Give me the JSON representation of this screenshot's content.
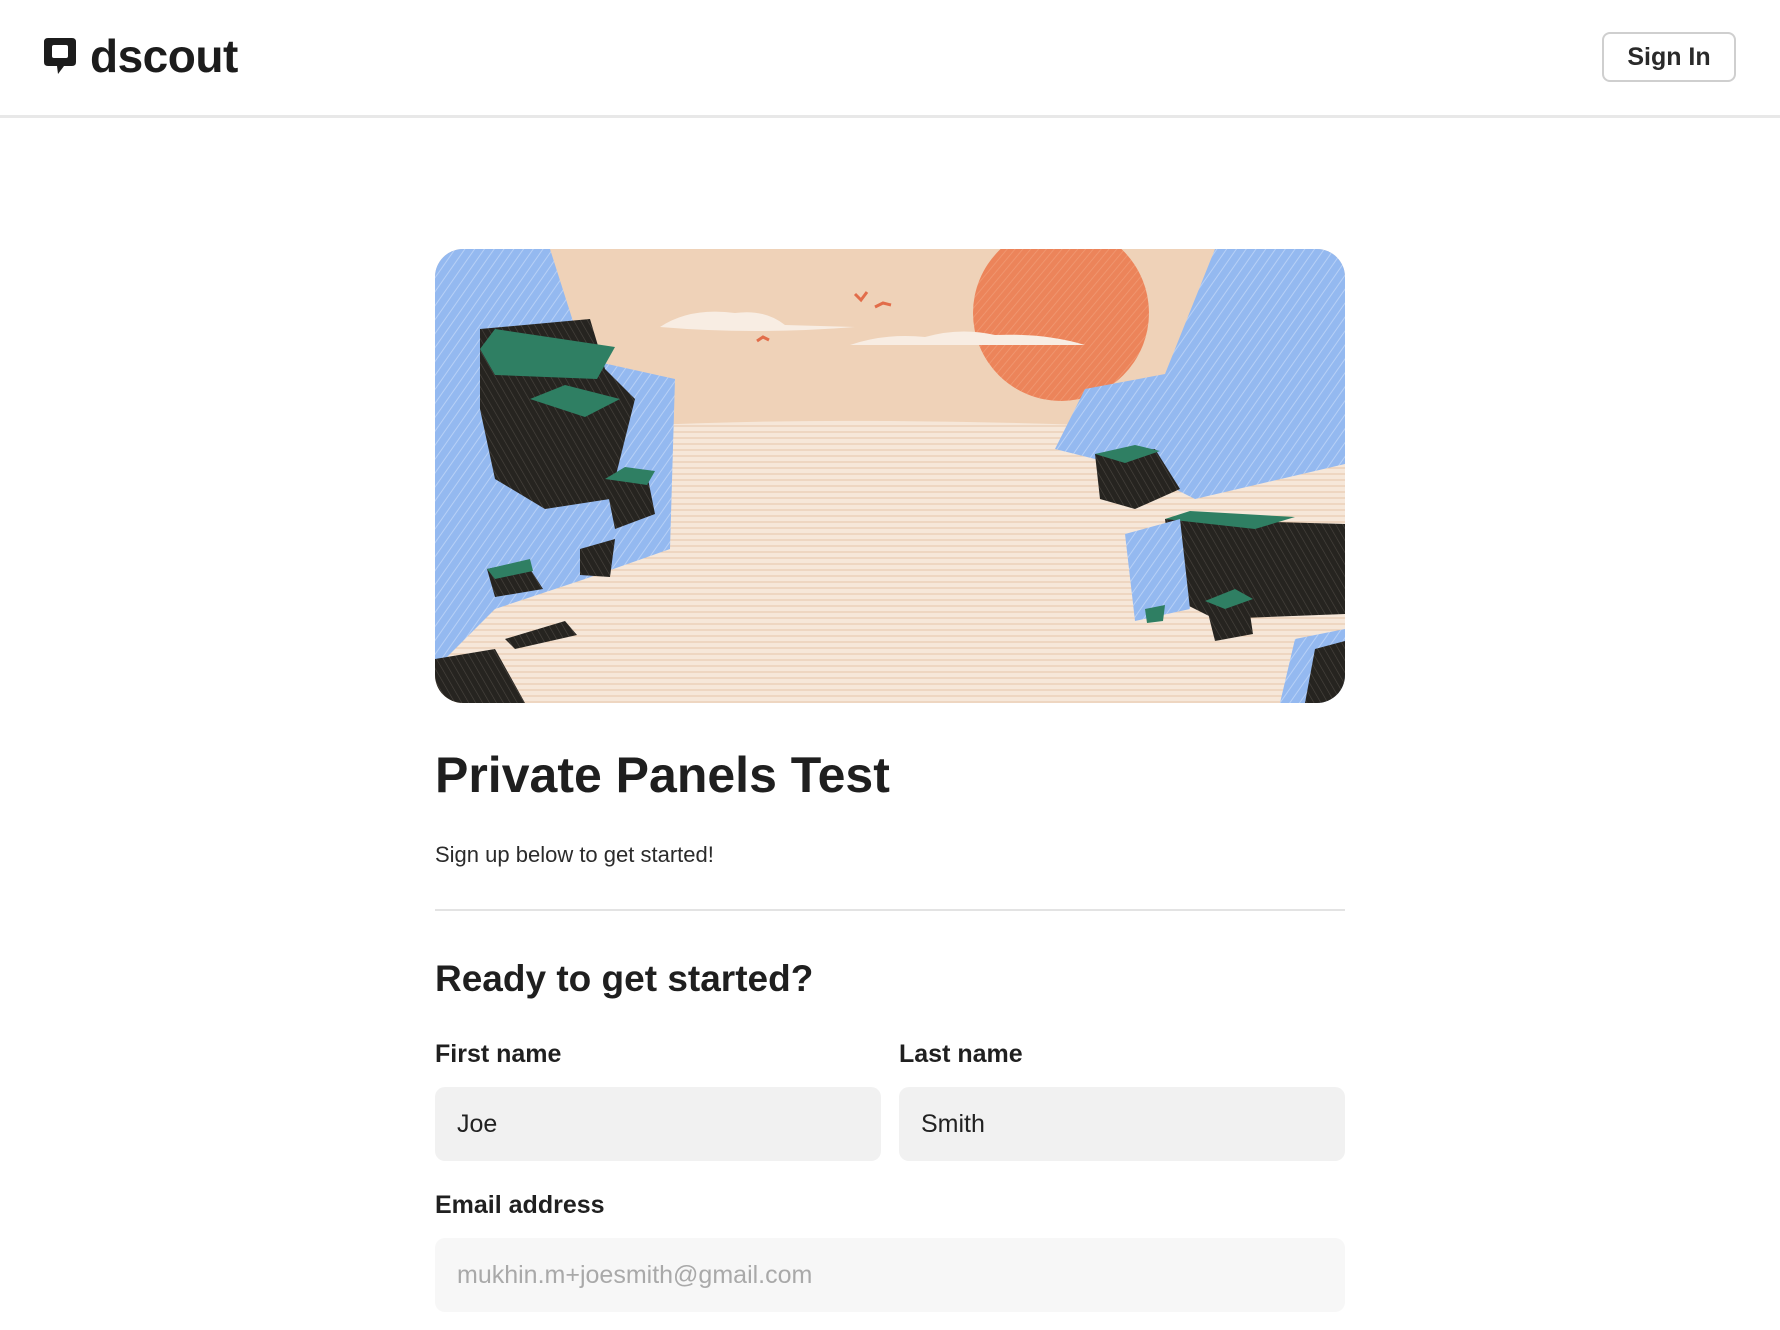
{
  "header": {
    "logo_text": "dscout",
    "logo_icon": "speech-bubble-icon",
    "signin_label": "Sign In"
  },
  "hero": {
    "illustration": "desert-landscape-illustration",
    "colors": {
      "sky": "#efd2b8",
      "sun": "#ec845a",
      "rock_blue": "#94b9f0",
      "rock_dark": "#262420",
      "rock_green": "#2f7f63",
      "sand": "#f4e3d3"
    }
  },
  "page": {
    "title": "Private Panels Test",
    "subtitle": "Sign up below to get started!"
  },
  "form": {
    "heading": "Ready to get started?",
    "first_name_label": "First name",
    "first_name_value": "Joe",
    "last_name_label": "Last name",
    "last_name_value": "Smith",
    "email_label": "Email address",
    "email_placeholder": "mukhin.m+joesmith@gmail.com"
  }
}
